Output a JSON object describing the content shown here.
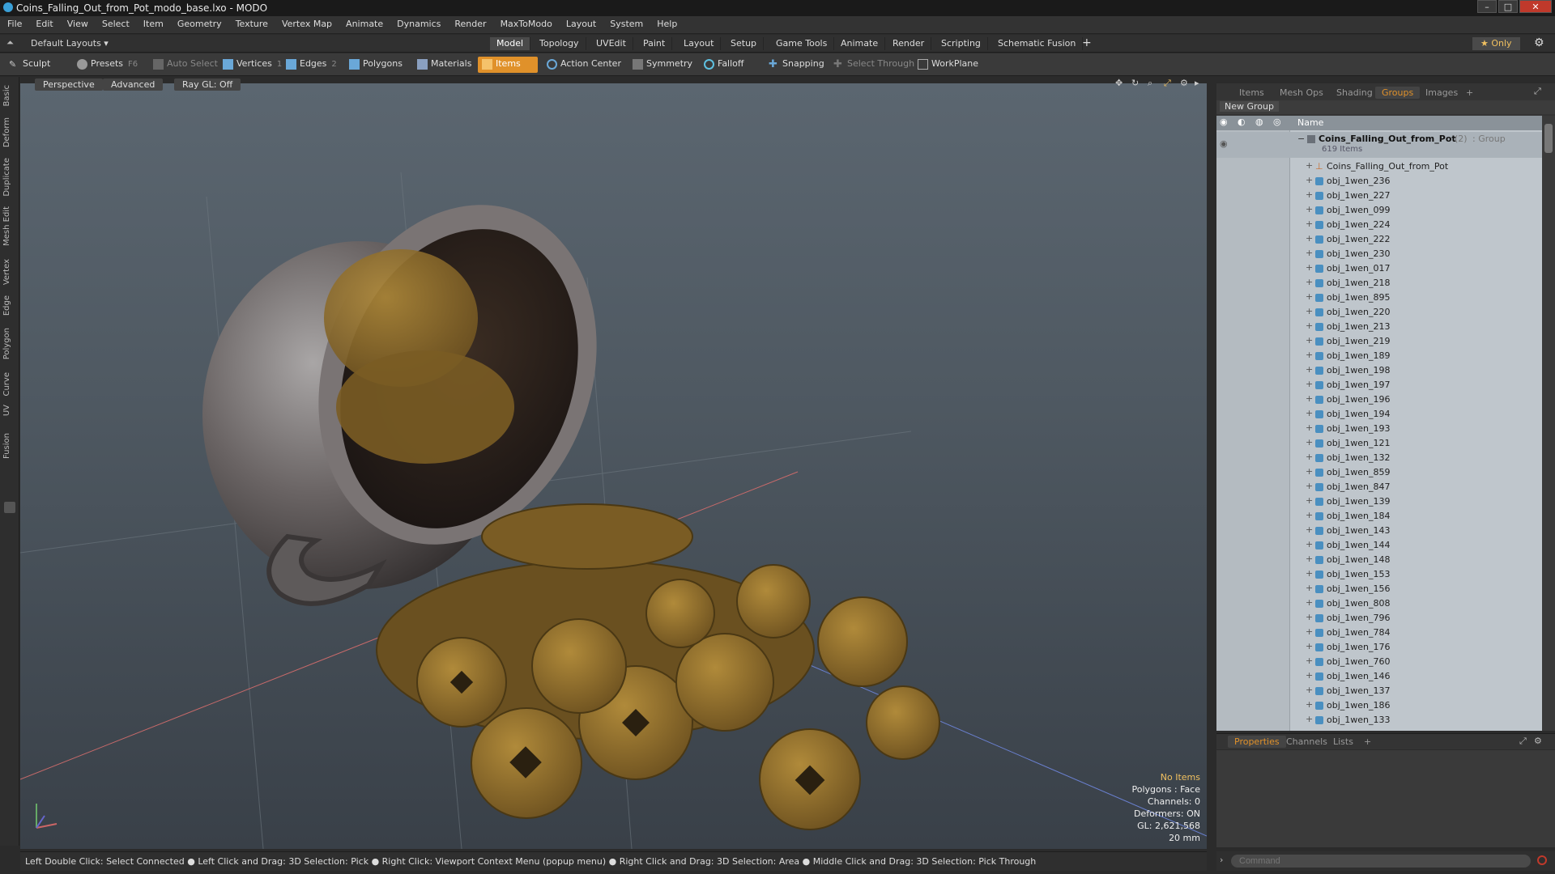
{
  "window": {
    "title": "Coins_Falling_Out_from_Pot_modo_base.lxo - MODO",
    "controls": [
      "–",
      "□",
      "✕"
    ]
  },
  "menu": [
    "File",
    "Edit",
    "View",
    "Select",
    "Item",
    "Geometry",
    "Texture",
    "Vertex Map",
    "Animate",
    "Dynamics",
    "Render",
    "MaxToModo",
    "Layout",
    "System",
    "Help"
  ],
  "layout_bar": {
    "layout_selector": "Default Layouts ▾",
    "tabs": [
      "Model",
      "Topology",
      "UVEdit",
      "Paint",
      "Layout",
      "Setup",
      "Game Tools",
      "Animate",
      "Render",
      "Scripting",
      "Schematic Fusion"
    ],
    "active_tab": "Model",
    "add_label": "+",
    "only_label": "★ Only"
  },
  "toolbar": {
    "sculpt": "Sculpt",
    "presets": "Presets",
    "presets_key": "F6",
    "auto_select": "Auto Select",
    "vertices": "Vertices",
    "vertices_count": "1",
    "edges": "Edges",
    "edges_count": "2",
    "polygons": "Polygons",
    "materials": "Materials",
    "items": "Items",
    "action_center": "Action Center",
    "symmetry": "Symmetry",
    "falloff": "Falloff",
    "snapping": "Snapping",
    "select_through": "Select Through",
    "workplane": "WorkPlane"
  },
  "left_tabs": [
    "Basic",
    "Deform",
    "Duplicate",
    "Mesh Edit",
    "Vertex",
    "Edge",
    "Polygon",
    "Curve",
    "UV",
    "Fusion"
  ],
  "viewport": {
    "view": "Perspective",
    "shading": "Advanced",
    "raygl": "Ray GL: Off",
    "hud": {
      "items": "No Items",
      "polygons": "Polygons : Face",
      "channels": "Channels: 0",
      "deformers": "Deformers: ON",
      "gl": "GL: 2,621,568",
      "scale": "20 mm"
    }
  },
  "status": "Left Double Click: Select Connected ● Left Click and Drag: 3D Selection: Pick ● Right Click: Viewport Context Menu (popup menu) ● Right Click and Drag: 3D Selection: Area ● Middle Click and Drag: 3D Selection: Pick Through",
  "right_panel": {
    "tabs": [
      "Items",
      "Mesh Ops",
      "Shading",
      "Groups",
      "Images"
    ],
    "active_tab": "Groups",
    "add_tab": "+",
    "new_group": "New Group",
    "column_name": "Name",
    "group": {
      "name": "Coins_Falling_Out_from_Pot",
      "count": "(2)",
      "type": ": Group",
      "item_count": "619 Items",
      "locator": "Coins_Falling_Out_from_Pot"
    },
    "items": [
      "obj_1wen_236",
      "obj_1wen_227",
      "obj_1wen_099",
      "obj_1wen_224",
      "obj_1wen_222",
      "obj_1wen_230",
      "obj_1wen_017",
      "obj_1wen_218",
      "obj_1wen_895",
      "obj_1wen_220",
      "obj_1wen_213",
      "obj_1wen_219",
      "obj_1wen_189",
      "obj_1wen_198",
      "obj_1wen_197",
      "obj_1wen_196",
      "obj_1wen_194",
      "obj_1wen_193",
      "obj_1wen_121",
      "obj_1wen_132",
      "obj_1wen_859",
      "obj_1wen_847",
      "obj_1wen_139",
      "obj_1wen_184",
      "obj_1wen_143",
      "obj_1wen_144",
      "obj_1wen_148",
      "obj_1wen_153",
      "obj_1wen_156",
      "obj_1wen_808",
      "obj_1wen_796",
      "obj_1wen_784",
      "obj_1wen_176",
      "obj_1wen_760",
      "obj_1wen_146",
      "obj_1wen_137",
      "obj_1wen_186",
      "obj_1wen_133"
    ],
    "prop_tabs": [
      "Properties",
      "Channels",
      "Lists"
    ],
    "prop_active": "Properties",
    "prop_add": "+",
    "command_placeholder": "Command"
  },
  "colors": {
    "accent": "#e0912a",
    "tree_bg": "#bfc6cc",
    "viewport_top": "#5b6670",
    "viewport_bottom": "#394048",
    "pot": "#6e6a6a",
    "coin": "#8a6a28"
  }
}
